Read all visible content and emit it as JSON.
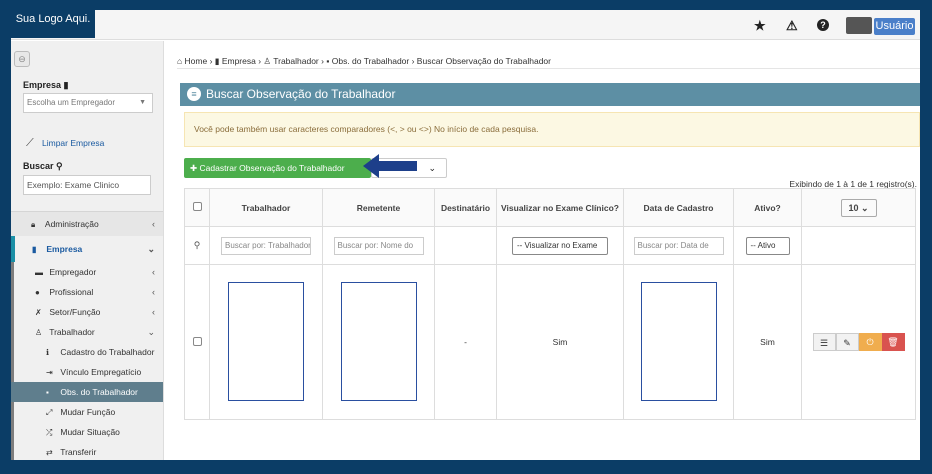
{
  "header": {
    "logo_text": "Sua Logo Aqui.",
    "icons": [
      "star-icon",
      "warning-icon",
      "help-icon"
    ],
    "user_label": "Usuário"
  },
  "sidebar": {
    "empresa_label": "Empresa",
    "empresa_placeholder": "Escolha um Empregador",
    "limpar_label": "Limpar Empresa",
    "buscar_label": "Buscar",
    "buscar_value": "Exemplo: Exame Clinico",
    "menu": [
      {
        "label": "Administração",
        "level": 0,
        "arrow": "‹"
      },
      {
        "label": "Empresa",
        "level": 0,
        "arrow": "⌄"
      },
      {
        "label": "Empregador",
        "level": 1,
        "arrow": "‹"
      },
      {
        "label": "Profissional",
        "level": 1,
        "arrow": "‹"
      },
      {
        "label": "Setor/Função",
        "level": 1,
        "arrow": "‹"
      },
      {
        "label": "Trabalhador",
        "level": 1,
        "arrow": "⌄"
      },
      {
        "label": "Cadastro do Trabalhador",
        "level": 2
      },
      {
        "label": "Vínculo Empregatício",
        "level": 2
      },
      {
        "label": "Obs. do Trabalhador",
        "level": 2,
        "active": true
      },
      {
        "label": "Mudar Função",
        "level": 2
      },
      {
        "label": "Mudar Situação",
        "level": 2
      },
      {
        "label": "Transferir",
        "level": 2
      }
    ]
  },
  "breadcrumb": [
    "Home",
    "Empresa",
    "Trabalhador",
    "Obs. do Trabalhador",
    "Buscar Observação do Trabalhador"
  ],
  "panel": {
    "title": "Buscar Observação do Trabalhador",
    "alert": "Você pode também usar caracteres comparadores (<, > ou <>) No início de cada pesquisa.",
    "add_button": "Cadastrar Observação do Trabalhador",
    "info": "Exibindo de 1 à 1 de 1 registro(s).",
    "page_size": "10"
  },
  "table": {
    "columns": [
      "Trabalhador",
      "Remetente",
      "Destinatário",
      "Visualizar no Exame Clínico?",
      "Data de Cadastro",
      "Ativo?"
    ],
    "filters": {
      "trabalhador": "Buscar por: Trabalhador",
      "remetente": "Buscar por: Nome do",
      "visualizar": "-- Visualizar no Exame",
      "data": "Buscar por: Data de",
      "ativo": "-- Ativo"
    },
    "rows": [
      {
        "destinatario": "-",
        "visualizar": "Sim",
        "ativo": "Sim"
      }
    ]
  },
  "colors": {
    "navy": "#0b3d66",
    "panel_header": "#5d8fa4",
    "success": "#4cae4c",
    "warning": "#f0ad4e",
    "danger": "#d9534f"
  }
}
